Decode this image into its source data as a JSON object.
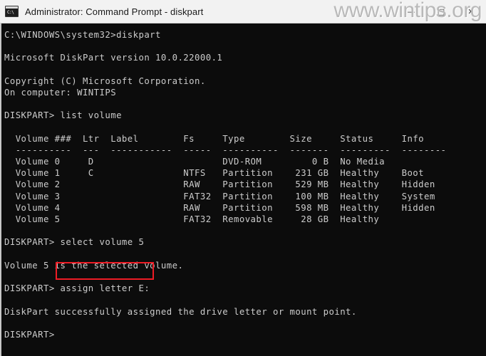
{
  "window": {
    "title": "Administrator: Command Prompt - diskpart",
    "icon": "command-prompt-icon",
    "icon_prompt_glyph": "C:\\",
    "controls": {
      "minimize": "—",
      "maximize": "□",
      "close": "✕"
    },
    "colors": {
      "titlebar_bg": "#f2f2f2",
      "titlebar_text": "#1a1a1a",
      "console_bg": "#0c0c0c",
      "console_text": "#cccccc",
      "highlight_border": "#ee1c25",
      "watermark_text": "#b9b9b9"
    }
  },
  "watermark": {
    "text": "www.wintips.org"
  },
  "console": {
    "lines": [
      "C:\\WINDOWS\\system32>diskpart",
      "",
      "Microsoft DiskPart version 10.0.22000.1",
      "",
      "Copyright (C) Microsoft Corporation.",
      "On computer: WINTIPS",
      "",
      "DISKPART> list volume",
      "",
      "  Volume ###  Ltr  Label        Fs     Type        Size     Status     Info",
      "  ----------  ---  -----------  -----  ----------  -------  ---------  --------",
      "  Volume 0     D                       DVD-ROM         0 B  No Media",
      "  Volume 1     C                NTFS   Partition    231 GB  Healthy    Boot",
      "  Volume 2                      RAW    Partition    529 MB  Healthy    Hidden",
      "  Volume 3                      FAT32  Partition    100 MB  Healthy    System",
      "  Volume 4                      RAW    Partition    598 MB  Healthy    Hidden",
      "  Volume 5                      FAT32  Removable     28 GB  Healthy",
      "",
      "DISKPART> select volume 5",
      "",
      "Volume 5 is the selected volume.",
      "",
      "DISKPART> assign letter E:",
      "",
      "DiskPart successfully assigned the drive letter or mount point.",
      "",
      "DISKPART>"
    ],
    "commands": {
      "launch": "diskpart",
      "list_volume": "list volume",
      "select_volume": "select volume 5",
      "assign_letter": "assign letter E:"
    },
    "prompt": "DISKPART>",
    "working_dir_prompt": "C:\\WINDOWS\\system32>",
    "version_line": "Microsoft DiskPart version 10.0.22000.1",
    "copyright_line": "Copyright (C) Microsoft Corporation.",
    "computer_line": "On computer: WINTIPS",
    "select_result": "Volume 5 is the selected volume.",
    "assign_result": "DiskPart successfully assigned the drive letter or mount point."
  },
  "volume_table": {
    "headers": [
      "Volume ###",
      "Ltr",
      "Label",
      "Fs",
      "Type",
      "Size",
      "Status",
      "Info"
    ],
    "rows": [
      {
        "volume": "Volume 0",
        "ltr": "D",
        "label": "",
        "fs": "",
        "type": "DVD-ROM",
        "size": "0 B",
        "status": "No Media",
        "info": ""
      },
      {
        "volume": "Volume 1",
        "ltr": "C",
        "label": "",
        "fs": "NTFS",
        "type": "Partition",
        "size": "231 GB",
        "status": "Healthy",
        "info": "Boot"
      },
      {
        "volume": "Volume 2",
        "ltr": "",
        "label": "",
        "fs": "RAW",
        "type": "Partition",
        "size": "529 MB",
        "status": "Healthy",
        "info": "Hidden"
      },
      {
        "volume": "Volume 3",
        "ltr": "",
        "label": "",
        "fs": "FAT32",
        "type": "Partition",
        "size": "100 MB",
        "status": "Healthy",
        "info": "System"
      },
      {
        "volume": "Volume 4",
        "ltr": "",
        "label": "",
        "fs": "RAW",
        "type": "Partition",
        "size": "598 MB",
        "status": "Healthy",
        "info": "Hidden"
      },
      {
        "volume": "Volume 5",
        "ltr": "",
        "label": "",
        "fs": "FAT32",
        "type": "Removable",
        "size": "28 GB",
        "status": "Healthy",
        "info": ""
      }
    ]
  },
  "highlight": {
    "target_text": "assign letter E:"
  }
}
